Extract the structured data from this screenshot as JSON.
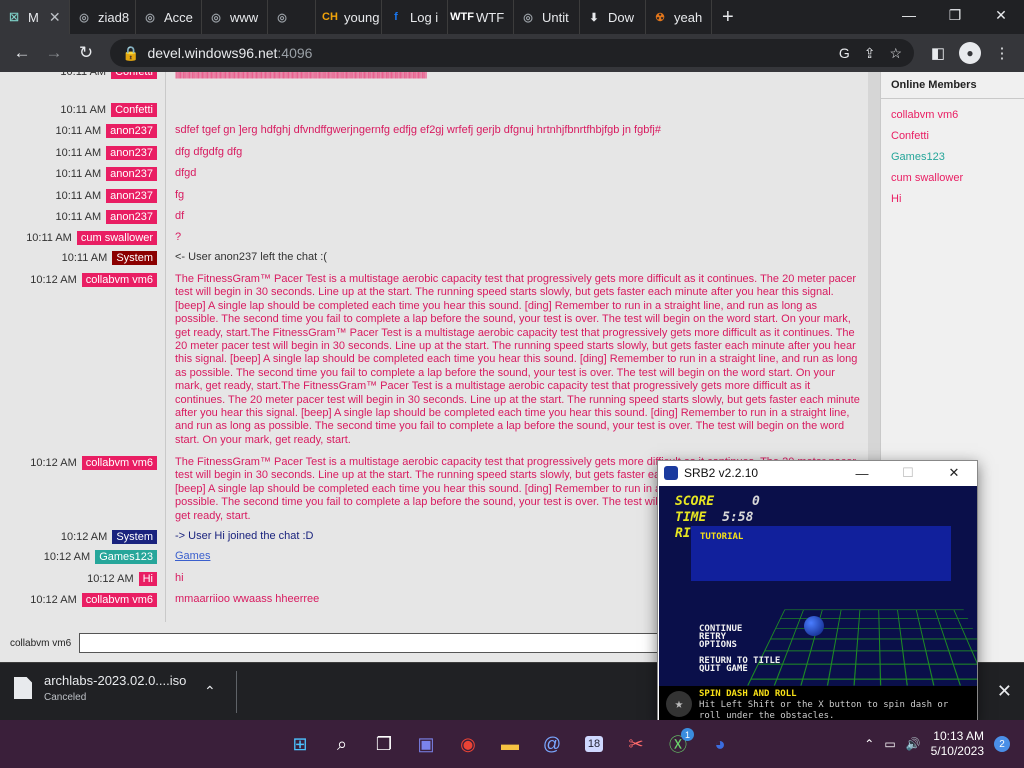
{
  "browser": {
    "tabs": [
      {
        "label": "M",
        "icon_text": "☒",
        "icon_color": "#7fd1c8"
      },
      {
        "label": "ziad8",
        "icon_text": "◎",
        "icon_color": "#9aa0a6"
      },
      {
        "label": "Acce",
        "icon_text": "◎",
        "icon_color": "#9aa0a6"
      },
      {
        "label": "www",
        "icon_text": "◎",
        "icon_color": "#9aa0a6"
      },
      {
        "label": "",
        "icon_text": "◎",
        "icon_color": "#9aa0a6"
      },
      {
        "label": "young",
        "icon_text": "CH",
        "icon_color": "#f0a30a"
      },
      {
        "label": "Log i",
        "icon_text": "f",
        "icon_color": "#1877f2"
      },
      {
        "label": "WTF",
        "icon_text": "WTF",
        "icon_color": "#ffffff"
      },
      {
        "label": "Untit",
        "icon_text": "◎",
        "icon_color": "#9aa0a6"
      },
      {
        "label": "Dow",
        "icon_text": "⬇",
        "icon_color": "#e8eaed"
      },
      {
        "label": "yeah",
        "icon_text": "☢",
        "icon_color": "#e2761b"
      }
    ],
    "url_host": "devel.windows96.net",
    "url_port": ":4096"
  },
  "chat": {
    "confetti_noise": "|||||||||||||||||||||||||||||||||||||||||||||||||||||||||||||||||||||||||||||||||||||||||||||||||||||||||||||||||||||||||||||||||||||||||||||||||||||||||||||||||||||||||||||||||||||||||||||||||||||||||||||||||||||||||||||||||||||||||||||||||||||||||||||||||||||||||||||||||||||||||||||||||||||||||||||||||||",
    "messages": [
      {
        "time": "10:11 AM",
        "user": "Confetti",
        "user_color": "#e91e63",
        "text": "",
        "pink": true
      },
      {
        "time": "10:11 AM",
        "user": "Confetti",
        "user_color": "#e91e63",
        "text": "",
        "pink": true
      },
      {
        "time": "10:11 AM",
        "user": "anon237",
        "user_color": "#e91e63",
        "text": "sdfef tgef gn ]erg hdfghj dfvndffgwerjngernfg edfjg ef2gj wrfefj gerjb dfgnuj hrtnhjfbnrtfhbjfgb jn fgbfj#",
        "pink": true
      },
      {
        "time": "10:11 AM",
        "user": "anon237",
        "user_color": "#e91e63",
        "text": "dfg dfgdfg dfg",
        "pink": true
      },
      {
        "time": "10:11 AM",
        "user": "anon237",
        "user_color": "#e91e63",
        "text": "dfgd",
        "pink": true
      },
      {
        "time": "10:11 AM",
        "user": "anon237",
        "user_color": "#e91e63",
        "text": "fg",
        "pink": true
      },
      {
        "time": "10:11 AM",
        "user": "anon237",
        "user_color": "#e91e63",
        "text": "df",
        "pink": true
      },
      {
        "time": "10:11 AM",
        "user": "cum swallower",
        "user_color": "#e91e63",
        "text": "?",
        "pink": true
      },
      {
        "time": "10:11 AM",
        "user": "System",
        "user_color": "#8b0000",
        "text": "<- User anon237 left the chat :(",
        "pink": false
      },
      {
        "time": "10:12 AM",
        "user": "collabvm vm6",
        "user_color": "#e91e63",
        "text": "The FitnessGram™ Pacer Test is a multistage aerobic capacity test that progressively gets more difficult as it continues. The 20 meter pacer test will begin in 30 seconds. Line up at the start. The running speed starts slowly, but gets faster each minute after you hear this signal. [beep] A single lap should be completed each time you hear this sound. [ding] Remember to run in a straight line, and run as long as possible. The second time you fail to complete a lap before the sound, your test is over. The test will begin on the word start. On your mark, get ready, start.The FitnessGram™ Pacer Test is a multistage aerobic capacity test that progressively gets more difficult as it continues. The 20 meter pacer test will begin in 30 seconds. Line up at the start. The running speed starts slowly, but gets faster each minute after you hear this signal. [beep] A single lap should be completed each time you hear this sound. [ding] Remember to run in a straight line, and run as long as possible. The second time you fail to complete a lap before the sound, your test is over. The test will begin on the word start. On your mark, get ready, start.The FitnessGram™ Pacer Test is a multistage aerobic capacity test that progressively gets more difficult as it continues. The 20 meter pacer test will begin in 30 seconds. Line up at the start. The running speed starts slowly, but gets faster each minute after you hear this signal. [beep] A single lap should be completed each time you hear this sound. [ding] Remember to run in a straight line, and run as long as possible. The second time you fail to complete a lap before the sound, your test is over. The test will begin on the word start. On your mark, get ready, start.",
        "pink": true
      },
      {
        "time": "10:12 AM",
        "user": "collabvm vm6",
        "user_color": "#e91e63",
        "text": "The FitnessGram™ Pacer Test is a multistage aerobic capacity test that progressively gets more difficult as it continues. The 20 meter pacer test will begin in 30 seconds. Line up at the start. The running speed starts slowly, but gets faster each minute after you hear this signal. [beep] A single lap should be completed each time you hear this sound. [ding] Remember to run in a straight line, and run as long as possible. The second time you fail to complete a lap before the sound, your test is over. The test will begin on the word start. On your mark, get ready, start.",
        "pink": true
      },
      {
        "time": "10:12 AM",
        "user": "System",
        "user_color": "#1a237e",
        "text": "-> User Hi joined the chat :D",
        "pink": false
      },
      {
        "time": "10:12 AM",
        "user": "Games123",
        "user_color": "#26a69a",
        "text": "Games",
        "pink": false,
        "link": true
      },
      {
        "time": "10:12 AM",
        "user": "Hi",
        "user_color": "#e91e63",
        "text": "hi",
        "pink": true
      },
      {
        "time": "10:12 AM",
        "user": "collabvm vm6",
        "user_color": "#e91e63",
        "text": "mmaarriioo  wwaass  hheerree",
        "pink": true
      }
    ],
    "input_label": "collabvm vm6",
    "input_value": ""
  },
  "members": {
    "heading": "Online Members",
    "list": [
      {
        "name": "collabvm vm6",
        "color": "#e91e63"
      },
      {
        "name": "Confetti",
        "color": "#e91e63"
      },
      {
        "name": "Games123",
        "color": "#26a69a"
      },
      {
        "name": "cum swallower",
        "color": "#e91e63"
      },
      {
        "name": "Hi",
        "color": "#e91e63"
      }
    ]
  },
  "download": {
    "filename": "archlabs-2023.02.0....iso",
    "status": "Canceled"
  },
  "game": {
    "title": "SRB2 v2.2.10",
    "score_label": "SCORE",
    "score_value": "0",
    "time_label": "TIME",
    "time_value": "5:58",
    "rings_label": "RI",
    "banner": "TUTORIAL",
    "menu": [
      "CONTINUE",
      "RETRY",
      "OPTIONS",
      "RETURN TO TITLE",
      "QUIT GAME"
    ],
    "tip_title": "SPIN DASH AND ROLL",
    "tip_text": "Hit Left Shift or the X button to spin dash or roll under the obstacles."
  },
  "taskbar": {
    "time": "10:13 AM",
    "date": "5/10/2023",
    "notifications": "2",
    "xbox_badge": "1",
    "calendar_day": "18"
  }
}
